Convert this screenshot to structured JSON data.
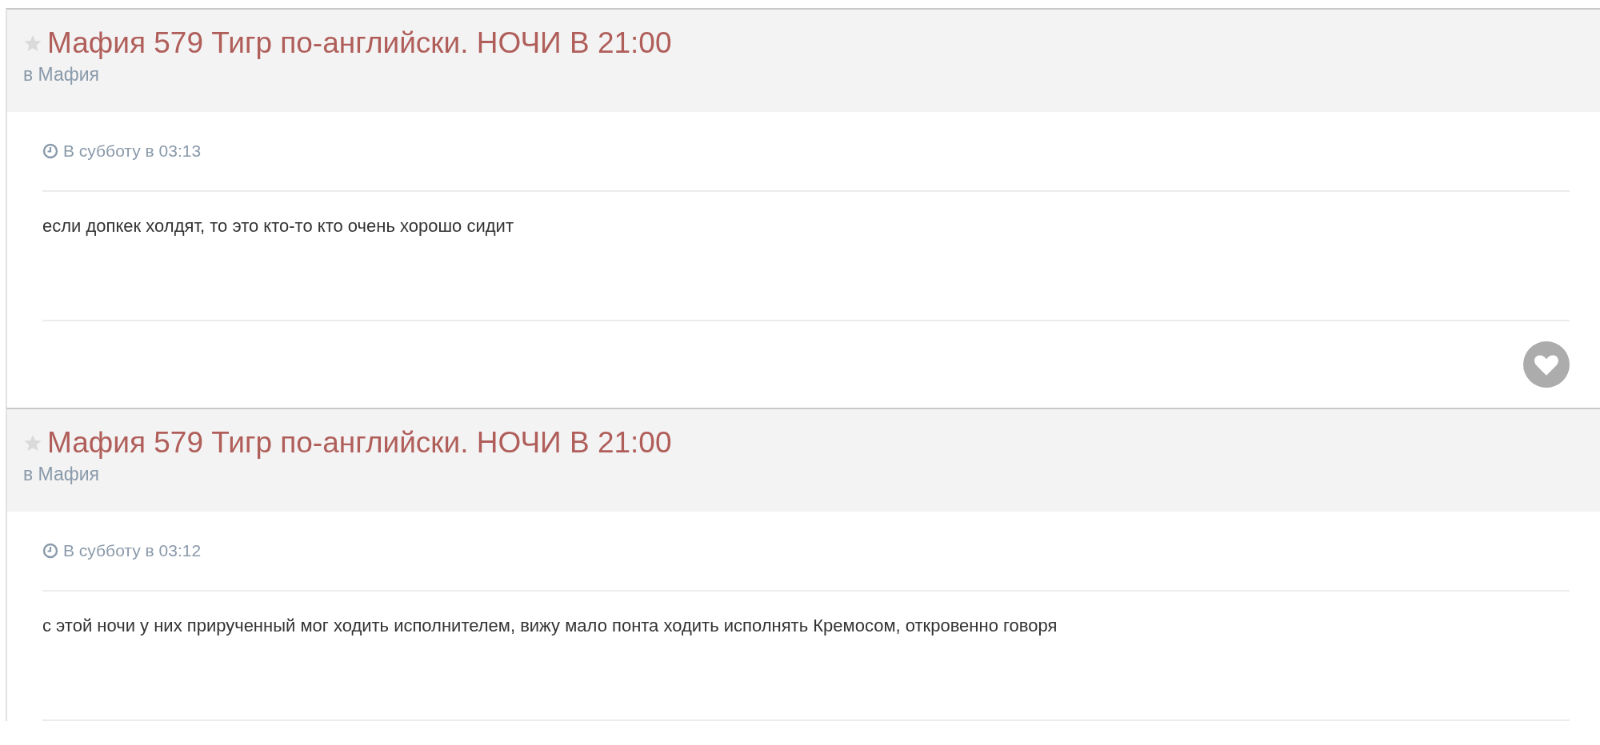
{
  "posts": [
    {
      "title": "Мафия 579 Тигр по-английски. НОЧИ В 21:00",
      "starred": false,
      "forum": "в Мафия",
      "time": "В субботу в 03:13",
      "text": "если допкек холдят, то это кто-то кто очень хорошо сидит",
      "liked": false
    },
    {
      "title": "Мафия 579 Тигр по-английски. НОЧИ В 21:00",
      "starred": false,
      "forum": "в Мафия",
      "time": "В субботу в 03:12",
      "text": "с этой ночи у них прирученный мог ходить исполнителем, вижу мало понта ходить исполнять Кремосом, откровенно говоря"
    }
  ]
}
